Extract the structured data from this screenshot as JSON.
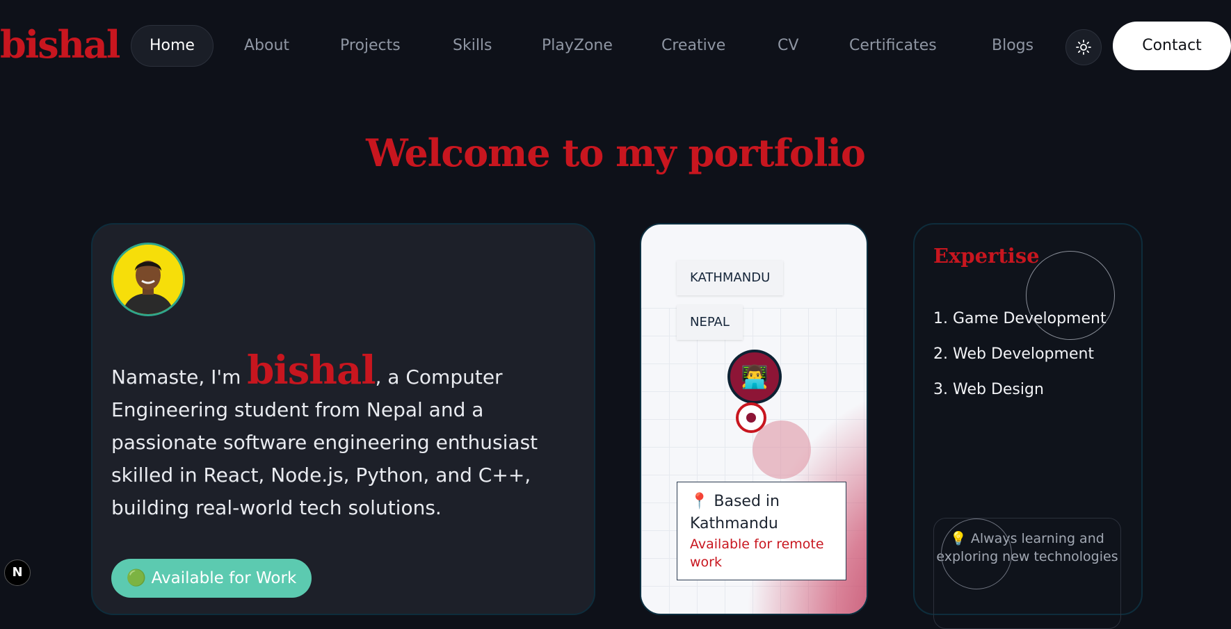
{
  "brand": {
    "logo": "bishal",
    "accent": "#c8161f"
  },
  "nav": {
    "items": [
      {
        "label": "Home",
        "active": true
      },
      {
        "label": "About"
      },
      {
        "label": "Projects"
      },
      {
        "label": "Skills"
      },
      {
        "label": "PlayZone"
      },
      {
        "label": "Creative"
      },
      {
        "label": "CV"
      },
      {
        "label": "Certificates"
      },
      {
        "label": "Blogs"
      }
    ],
    "theme_icon": "sun-icon",
    "contact": "Contact"
  },
  "hero": {
    "title": "Welcome to my portfolio"
  },
  "intro": {
    "greeting": "Namaste, I'm ",
    "name": "bishal",
    "description": ", a Computer Engineering student from Nepal and a passionate software engineering enthusiast skilled in React, Node.js, Python, and C++, building real-world tech solutions.",
    "available_label": "🟢 Available for Work"
  },
  "map": {
    "city": "KATHMANDU",
    "country": "NEPAL",
    "pin_emoji": "👨‍💻",
    "based_title": "📍 Based in Kathmandu",
    "based_sub": "Available for remote work"
  },
  "expertise": {
    "title": "Expertise",
    "items": [
      "1. Game Development",
      "2. Web Development",
      "3. Web Design"
    ],
    "learning": "💡 Always learning and exploring new technologies"
  },
  "badge": {
    "label": "N"
  }
}
